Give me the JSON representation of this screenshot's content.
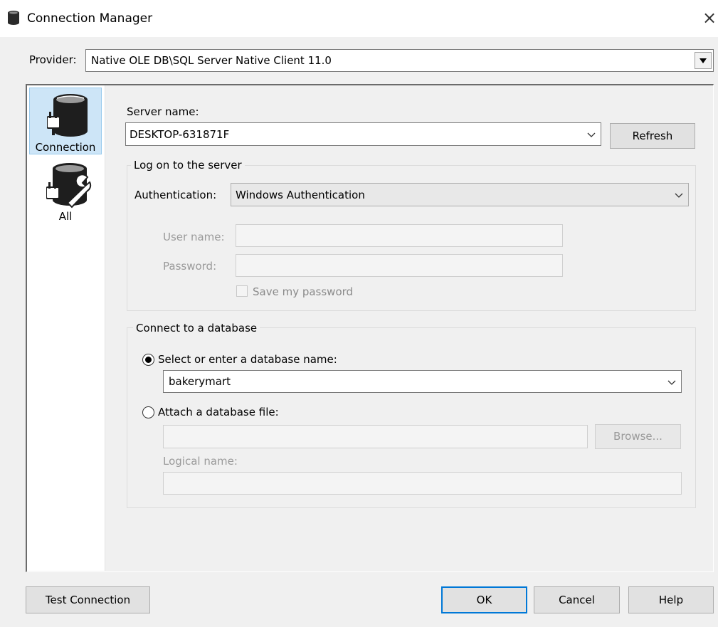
{
  "window": {
    "title": "Connection Manager",
    "close_glyph": "×"
  },
  "provider": {
    "label": "Provider:",
    "value": "Native OLE DB\\SQL Server Native Client 11.0"
  },
  "nav": {
    "items": [
      {
        "label": "Connection",
        "icon": "database-plug-icon",
        "selected": true
      },
      {
        "label": "All",
        "icon": "database-plug-wrench-icon",
        "selected": false
      }
    ]
  },
  "connection": {
    "server_name_label": "Server name:",
    "server_name_value": "DESKTOP-631871F",
    "refresh_label": "Refresh",
    "logon_group_title": "Log on to the server",
    "authentication_label": "Authentication:",
    "authentication_value": "Windows Authentication",
    "user_name_label": "User name:",
    "user_name_value": "",
    "password_label": "Password:",
    "password_value": "",
    "save_password_label": "Save my password",
    "database_group_title": "Connect to a database",
    "select_db_label": "Select or enter a database name:",
    "select_db_value": "bakerymart",
    "attach_db_label": "Attach a database file:",
    "attach_db_value": "",
    "browse_label": "Browse...",
    "logical_name_label": "Logical name:",
    "logical_name_value": ""
  },
  "buttons": {
    "test_connection": "Test Connection",
    "ok": "OK",
    "cancel": "Cancel",
    "help": "Help"
  },
  "colors": {
    "selection_bg": "#cde5f7",
    "focus_border": "#0078d7",
    "dialog_bg": "#f0f0f0"
  }
}
